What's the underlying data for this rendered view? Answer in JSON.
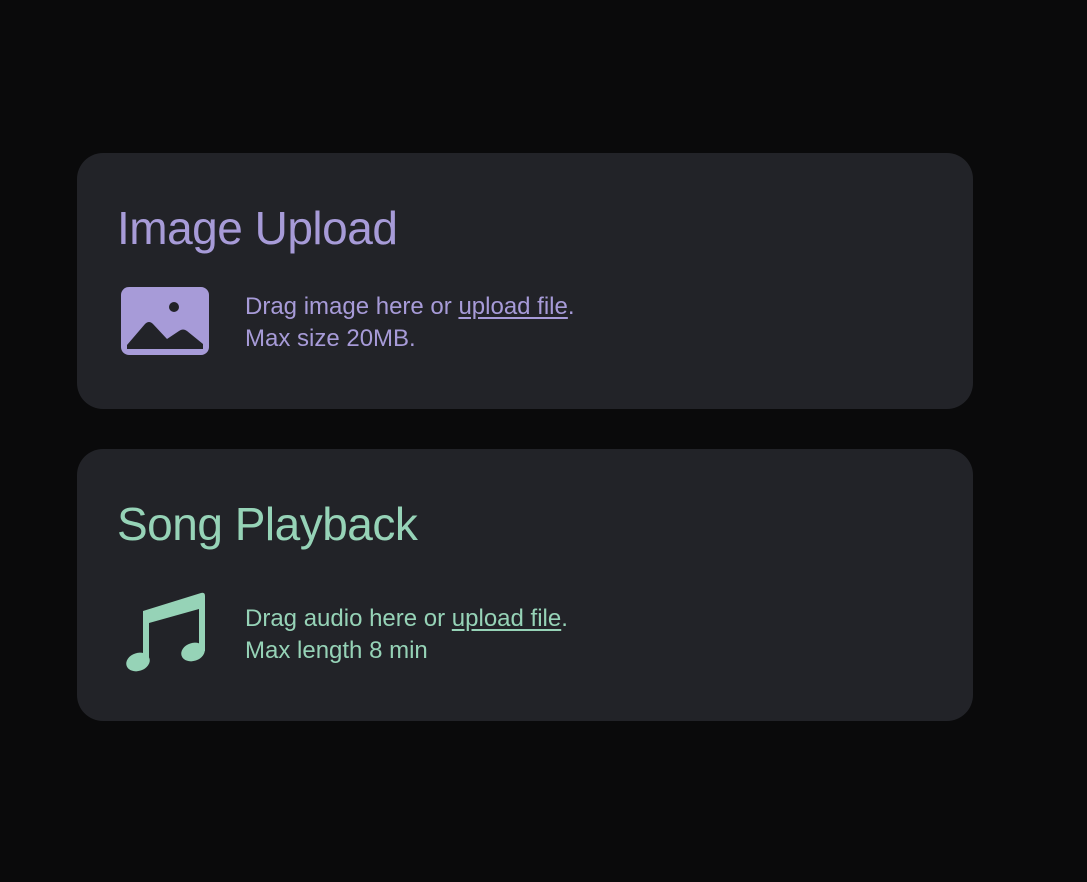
{
  "colors": {
    "background": "#0a0a0b",
    "card": "#222328",
    "image_accent": "#a79bd8",
    "song_accent": "#96d3b7"
  },
  "image_upload": {
    "title": "Image Upload",
    "icon": "image-icon",
    "drag_text": "Drag image here or ",
    "link_label": "upload file",
    "period": ".",
    "max_text": "Max size 20MB."
  },
  "song_playback": {
    "title": "Song Playback",
    "icon": "music-note-icon",
    "drag_text": "Drag audio here or ",
    "link_label": "upload file",
    "period": ".",
    "max_text": "Max length 8 min"
  }
}
